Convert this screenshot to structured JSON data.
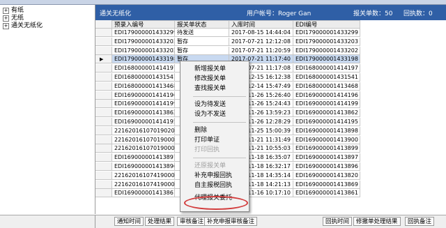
{
  "tree": {
    "items": [
      {
        "expander": "+",
        "label": "有纸"
      },
      {
        "expander": "+",
        "label": "无纸"
      },
      {
        "expander": "+",
        "label": "通关无纸化"
      }
    ]
  },
  "header": {
    "title": "通关无纸化",
    "user_label": "用户帐号：Roger Gan",
    "count_label": "报关单数：50",
    "receipt_label": "回执数：0"
  },
  "grid": {
    "columns": [
      "预录入编号",
      "报关单状态",
      "入库时间",
      "EDI编号"
    ],
    "rows": [
      [
        "EDI179000001433299",
        "待发送",
        "2017-08-15 14:44:04",
        "EDI179000001433299"
      ],
      [
        "EDI179000001433203",
        "暂存",
        "2017-07-21 12:12:08",
        "EDI179000001433203"
      ],
      [
        "EDI179000001433202",
        "暂存",
        "2017-07-21 11:20:59",
        "EDI179000001433202"
      ],
      [
        "EDI179000001433198",
        "暂存",
        "2017-07-21 11:17:40",
        "EDI179000001433198"
      ],
      [
        "EDI168000001414197",
        "",
        "2017-07-21 11:17:08",
        "EDI168000001414197"
      ],
      [
        "EDI168000001431541",
        "",
        "2016-12-15 16:12:38",
        "EDI168000001431541"
      ],
      [
        "EDI168000001413468",
        "",
        "2016-12-14 15:47:49",
        "EDI168000001413468"
      ],
      [
        "EDI169000001414196",
        "",
        "2016-11-26 15:26:40",
        "EDI169000001414196"
      ],
      [
        "EDI169000001414199",
        "",
        "2016-11-26 15:24:43",
        "EDI169000001414199"
      ],
      [
        "EDI169000001413862",
        "",
        "2016-11-26 13:59:23",
        "EDI169000001413862"
      ],
      [
        "EDI169000001414195",
        "",
        "2016-11-26 12:28:29",
        "EDI169000001414195"
      ],
      [
        "221620161070190208",
        "",
        "2016-11-25 15:00:39",
        "EDI169000001413898"
      ],
      [
        "221620161070190007",
        "",
        "2016-11-21 11:31:49",
        "EDI169000001413900"
      ],
      [
        "221620161070190006",
        "",
        "2016-11-21 10:55:03",
        "EDI169000001413899"
      ],
      [
        "EDI169000001413897",
        "",
        "2016-11-18 16:35:07",
        "EDI169000001413897"
      ],
      [
        "EDI169000001413896",
        "",
        "2016-11-18 16:32:17",
        "EDI169000001413896"
      ],
      [
        "221620161074190005",
        "",
        "2016-11-18 14:35:14",
        "EDI169000001413820"
      ],
      [
        "221620161074190004",
        "",
        "2016-11-18 14:21:13",
        "EDI169000001413869"
      ],
      [
        "EDI169000001413861",
        "",
        "2016-11-16 10:17:10",
        "EDI169000001413861"
      ]
    ]
  },
  "context_menu": {
    "items": [
      {
        "label": "新增报关单",
        "disabled": false
      },
      {
        "label": "修改报关单",
        "disabled": false
      },
      {
        "label": "查找报关单",
        "disabled": false
      },
      {
        "label": "设为待发送",
        "disabled": false
      },
      {
        "label": "设为不发送",
        "disabled": false
      },
      {
        "label": "删除",
        "disabled": false
      },
      {
        "label": "打印单证",
        "disabled": false
      },
      {
        "label": "打印回执",
        "disabled": true
      },
      {
        "label": "还原报关单",
        "disabled": true
      },
      {
        "label": "补充申报回执",
        "disabled": false
      },
      {
        "label": "自主报税回执",
        "disabled": false
      },
      {
        "label": "代理报关委托",
        "disabled": false
      }
    ],
    "highlight_color": "#d23b3b"
  },
  "bottom_tabs": {
    "left": [
      "通知时间",
      "处理结果",
      "审核备注",
      "补充申报审核备注"
    ],
    "right": [
      "回执时间",
      "修撤单处理结果",
      "回执备注"
    ]
  },
  "colors": {
    "header_bg": "#2f5fa6",
    "selection_bg": "#c8d9f0"
  }
}
